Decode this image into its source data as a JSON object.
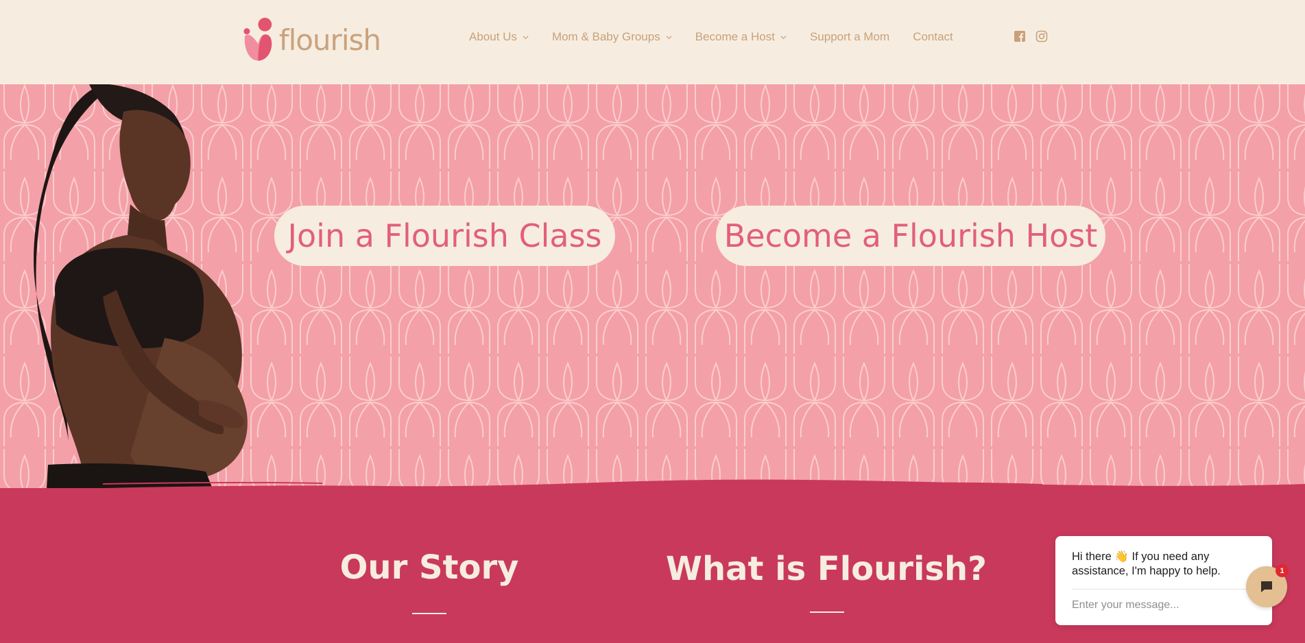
{
  "brand": {
    "name": "flourish",
    "colors": {
      "cream": "#f6ede0",
      "tan": "#c9a07a",
      "pink": "#f4a0a8",
      "rose": "#e25f7b",
      "crimson": "#c9395b"
    }
  },
  "nav": {
    "items": [
      {
        "label": "About Us",
        "has_dropdown": true
      },
      {
        "label": "Mom & Baby Groups",
        "has_dropdown": true
      },
      {
        "label": "Become a Host",
        "has_dropdown": true
      },
      {
        "label": "Support a Mom",
        "has_dropdown": false
      },
      {
        "label": "Contact",
        "has_dropdown": false
      }
    ],
    "social": [
      "facebook-icon",
      "instagram-icon"
    ]
  },
  "hero": {
    "cta_join": "Join a Flourish Class",
    "cta_host": "Become a Flourish Host"
  },
  "sections": {
    "story_title": "Our Story",
    "what_title": "What is Flourish?"
  },
  "chat": {
    "greeting_prefix": "Hi there",
    "greeting_emoji": "👋",
    "greeting_rest": "If you need any assistance, I'm happy to help.",
    "placeholder": "Enter your message...",
    "badge_count": "1"
  }
}
